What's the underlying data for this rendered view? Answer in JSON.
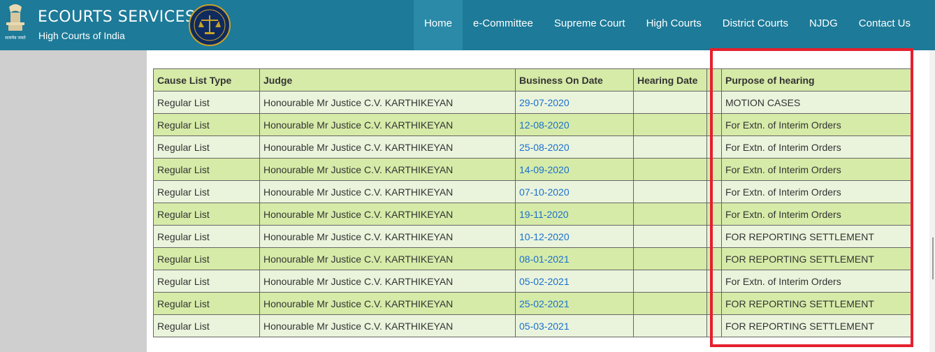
{
  "header": {
    "emblem_caption": "सत्यमेव जयते",
    "title": "ECOURTS SERVICES",
    "subtitle": "High Courts of India"
  },
  "nav": {
    "items": [
      "Home",
      "e-Committee",
      "Supreme Court",
      "High Courts",
      "District Courts",
      "NJDG",
      "Contact Us"
    ],
    "active": "Home"
  },
  "table": {
    "headers": [
      "Cause List Type",
      "Judge",
      "Business On Date",
      "Hearing Date",
      "",
      "Purpose of hearing"
    ],
    "rows": [
      {
        "type": "Regular List",
        "judge": "Honourable Mr Justice C.V. KARTHIKEYAN",
        "business_date": "29-07-2020",
        "hearing_date": "",
        "extra": "",
        "purpose": "MOTION CASES"
      },
      {
        "type": "Regular List",
        "judge": "Honourable Mr Justice C.V. KARTHIKEYAN",
        "business_date": "12-08-2020",
        "hearing_date": "",
        "extra": "",
        "purpose": "For Extn. of Interim Orders"
      },
      {
        "type": "Regular List",
        "judge": "Honourable Mr Justice C.V. KARTHIKEYAN",
        "business_date": "25-08-2020",
        "hearing_date": "",
        "extra": "",
        "purpose": "For Extn. of Interim Orders"
      },
      {
        "type": "Regular List",
        "judge": "Honourable Mr Justice C.V. KARTHIKEYAN",
        "business_date": "14-09-2020",
        "hearing_date": "",
        "extra": "",
        "purpose": "For Extn. of Interim Orders"
      },
      {
        "type": "Regular List",
        "judge": "Honourable Mr Justice C.V. KARTHIKEYAN",
        "business_date": "07-10-2020",
        "hearing_date": "",
        "extra": "",
        "purpose": "For Extn. of Interim Orders"
      },
      {
        "type": "Regular List",
        "judge": "Honourable Mr Justice C.V. KARTHIKEYAN",
        "business_date": "19-11-2020",
        "hearing_date": "",
        "extra": "",
        "purpose": "For Extn. of Interim Orders"
      },
      {
        "type": "Regular List",
        "judge": "Honourable Mr Justice C.V. KARTHIKEYAN",
        "business_date": "10-12-2020",
        "hearing_date": "",
        "extra": "",
        "purpose": "FOR REPORTING SETTLEMENT"
      },
      {
        "type": "Regular List",
        "judge": "Honourable Mr Justice C.V. KARTHIKEYAN",
        "business_date": "08-01-2021",
        "hearing_date": "",
        "extra": "",
        "purpose": "FOR REPORTING SETTLEMENT"
      },
      {
        "type": "Regular List",
        "judge": "Honourable Mr Justice C.V. KARTHIKEYAN",
        "business_date": "05-02-2021",
        "hearing_date": "",
        "extra": "",
        "purpose": "For Extn. of Interim Orders"
      },
      {
        "type": "Regular List",
        "judge": "Honourable Mr Justice C.V. KARTHIKEYAN",
        "business_date": "25-02-2021",
        "hearing_date": "",
        "extra": "",
        "purpose": "FOR REPORTING SETTLEMENT"
      },
      {
        "type": "Regular List",
        "judge": "Honourable Mr Justice C.V. KARTHIKEYAN",
        "business_date": "05-03-2021",
        "hearing_date": "",
        "extra": "",
        "purpose": "FOR REPORTING SETTLEMENT"
      }
    ]
  },
  "colors": {
    "header_bg": "#1d7a98",
    "row_light": "#eaf4dc",
    "row_dark": "#d6eba8",
    "link": "#1a6fcf",
    "highlight": "#e5202e"
  }
}
